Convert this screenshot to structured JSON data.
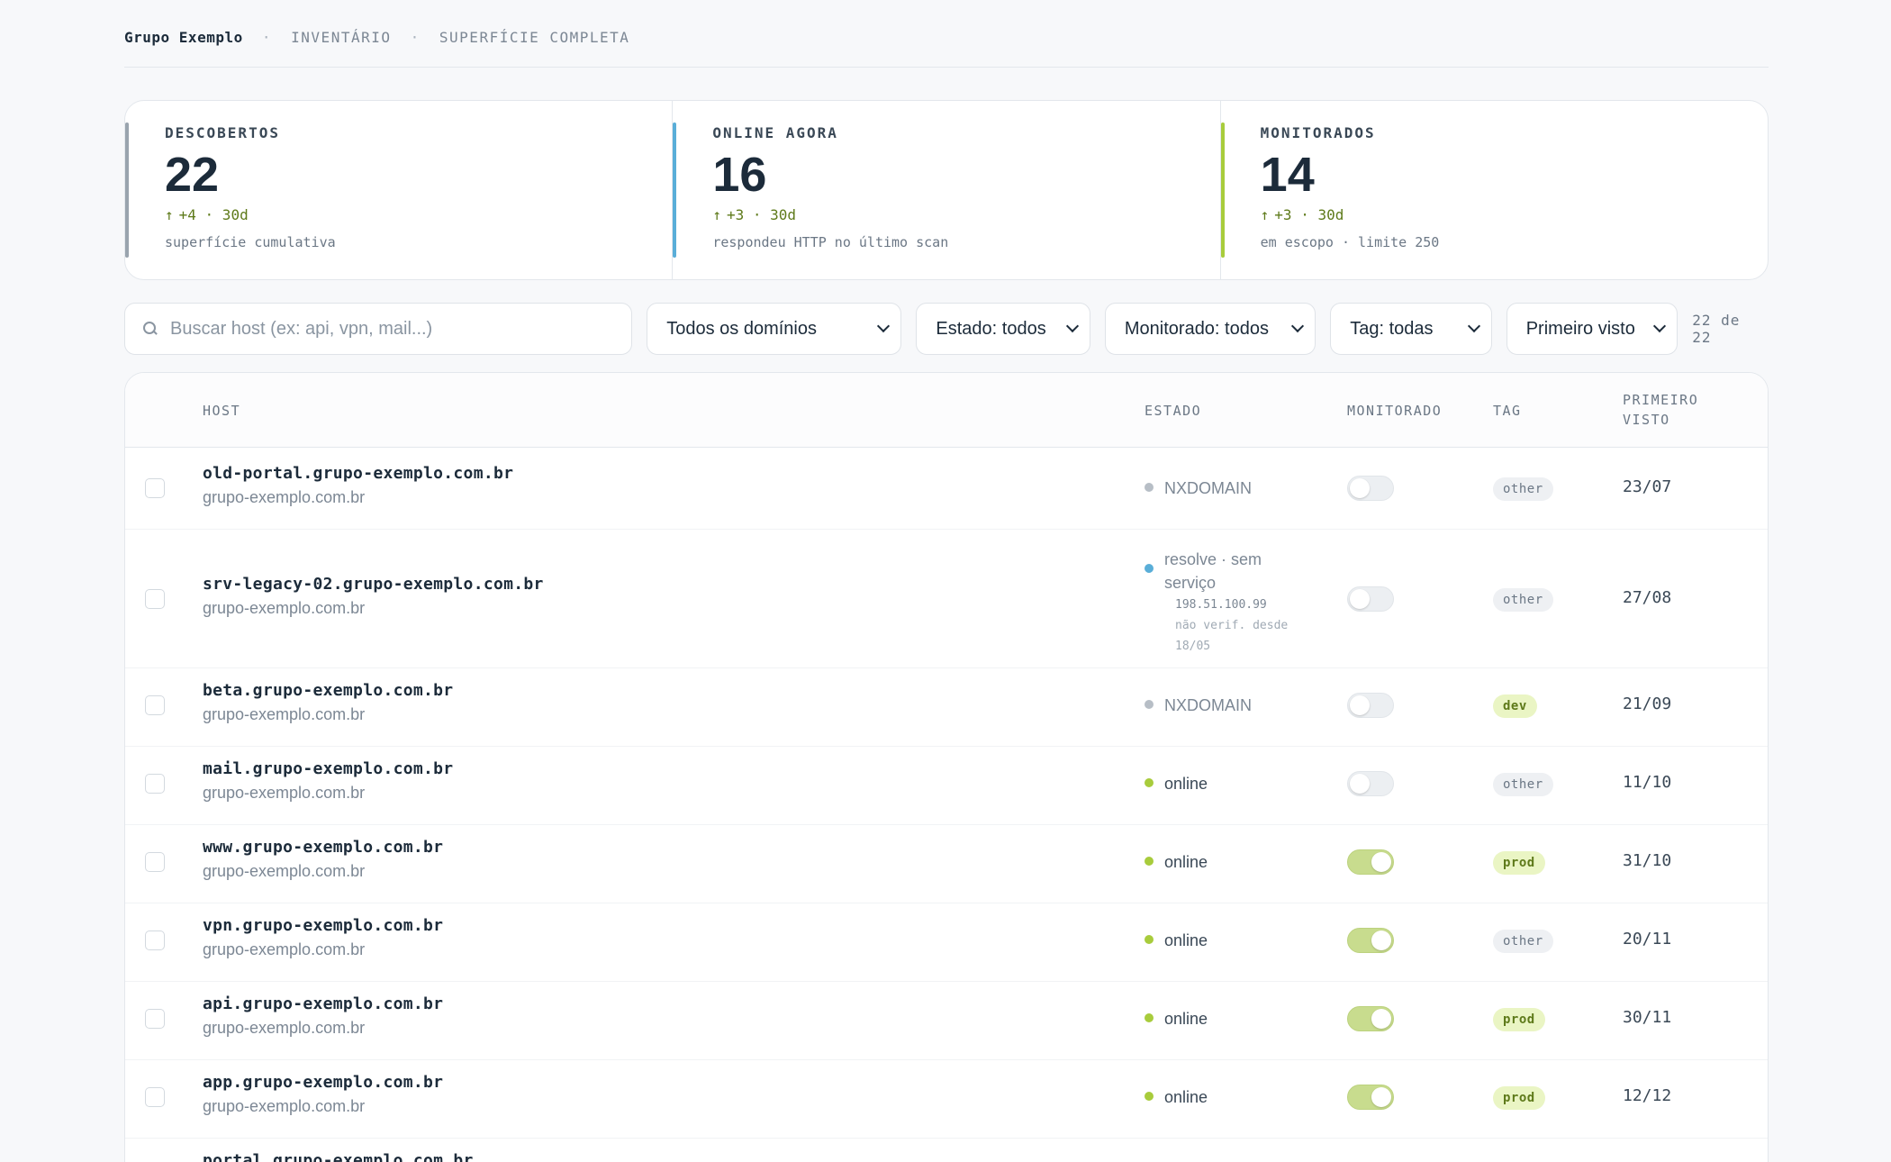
{
  "breadcrumb": {
    "org": "Grupo Exemplo",
    "sep": "·",
    "items": [
      "INVENTÁRIO",
      "SUPERFÍCIE COMPLETA"
    ]
  },
  "colors": {
    "descobertos": "#9aa4ae",
    "online": "#5aaed8",
    "monitorados": "#a8cc3c",
    "dot_gray": "#b7bec6",
    "dot_blue": "#5aaed8",
    "dot_green": "#a8cc3c"
  },
  "stats": [
    {
      "label": "DESCOBERTOS",
      "value": "22",
      "arrow": "↑",
      "delta": "+4 · 30d",
      "note": "superfície cumulativa"
    },
    {
      "label": "ONLINE AGORA",
      "value": "16",
      "arrow": "↑",
      "delta": "+3 · 30d",
      "note": "respondeu HTTP no último scan"
    },
    {
      "label": "MONITORADOS",
      "value": "14",
      "arrow": "↑",
      "delta": "+3 · 30d",
      "note": "em escopo · limite 250"
    }
  ],
  "filters": {
    "search_placeholder": "Buscar host (ex: api, vpn, mail...)",
    "domain": "Todos os domínios",
    "state": "Estado: todos",
    "monitored": "Monitorado: todos",
    "tag": "Tag: todas",
    "sort": "Primeiro visto",
    "count": "22 de 22"
  },
  "table": {
    "headers": {
      "host": "HOST",
      "state": "ESTADO",
      "monitored": "MONITORADO",
      "tag": "TAG",
      "first_line1": "PRIMEIRO",
      "first_line2": "VISTO"
    },
    "rows": [
      {
        "host": "old-portal.grupo-exemplo.com.br",
        "domain": "grupo-exemplo.com.br",
        "state": "NXDOMAIN",
        "monitored": false,
        "tag": "other",
        "first": "23/07"
      },
      {
        "host": "srv-legacy-02.grupo-exemplo.com.br",
        "domain": "grupo-exemplo.com.br",
        "state_line1": "resolve · sem",
        "state_line2": "serviço",
        "ip": "198.51.100.99",
        "note": "não verif. desde 18/05",
        "monitored": false,
        "tag": "other",
        "first": "27/08"
      },
      {
        "host": "beta.grupo-exemplo.com.br",
        "domain": "grupo-exemplo.com.br",
        "state": "NXDOMAIN",
        "monitored": false,
        "tag": "dev",
        "first": "21/09"
      },
      {
        "host": "mail.grupo-exemplo.com.br",
        "domain": "grupo-exemplo.com.br",
        "state": "online",
        "monitored": false,
        "tag": "other",
        "first": "11/10"
      },
      {
        "host": "www.grupo-exemplo.com.br",
        "domain": "grupo-exemplo.com.br",
        "state": "online",
        "monitored": true,
        "tag": "prod",
        "first": "31/10"
      },
      {
        "host": "vpn.grupo-exemplo.com.br",
        "domain": "grupo-exemplo.com.br",
        "state": "online",
        "monitored": true,
        "tag": "other",
        "first": "20/11"
      },
      {
        "host": "api.grupo-exemplo.com.br",
        "domain": "grupo-exemplo.com.br",
        "state": "online",
        "monitored": true,
        "tag": "prod",
        "first": "30/11"
      },
      {
        "host": "app.grupo-exemplo.com.br",
        "domain": "grupo-exemplo.com.br",
        "state": "online",
        "monitored": true,
        "tag": "prod",
        "first": "12/12"
      },
      {
        "host": "portal.grupo-exemplo.com.br"
      }
    ]
  }
}
